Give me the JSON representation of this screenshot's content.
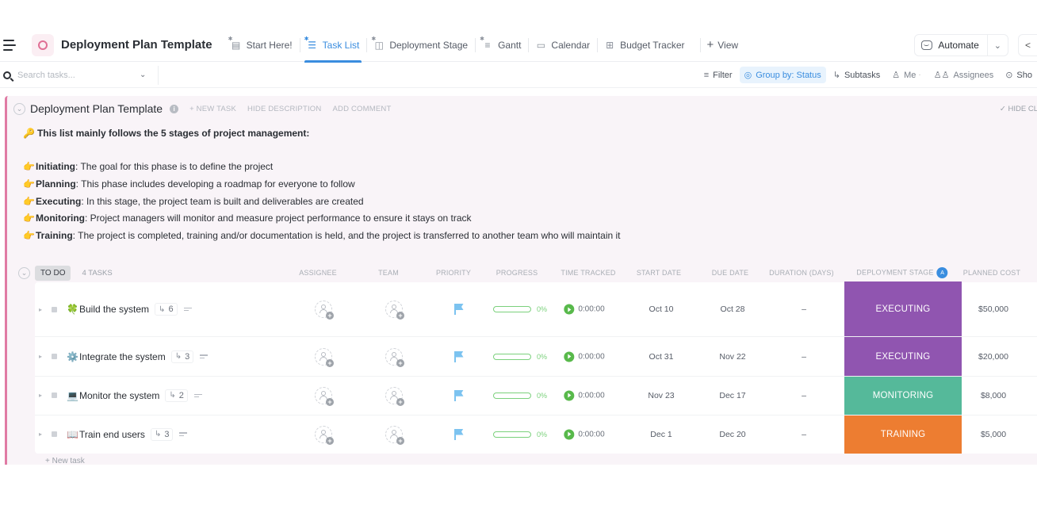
{
  "header": {
    "list_title": "Deployment Plan Template",
    "tabs": [
      {
        "label": "Start Here!",
        "icon": "doc-icon",
        "active": false
      },
      {
        "label": "Task List",
        "icon": "list-icon",
        "active": true
      },
      {
        "label": "Deployment Stage",
        "icon": "board-icon",
        "active": false
      },
      {
        "label": "Gantt",
        "icon": "gantt-icon",
        "active": false
      },
      {
        "label": "Calendar",
        "icon": "calendar-icon",
        "active": false
      },
      {
        "label": "Budget Tracker",
        "icon": "table-icon",
        "active": false
      }
    ],
    "add_view_label": "View",
    "automate_label": "Automate"
  },
  "toolbar": {
    "search_placeholder": "Search tasks...",
    "filter_label": "Filter",
    "group_by_label": "Group by: Status",
    "subtasks_label": "Subtasks",
    "me_label": "Me",
    "assignees_label": "Assignees",
    "show_label": "Sho"
  },
  "list": {
    "title": "Deployment Plan Template",
    "actions": [
      "+ NEW TASK",
      "HIDE DESCRIPTION",
      "ADD COMMENT"
    ],
    "hide_closed_label": "HIDE CL",
    "description": {
      "intro": "This list mainly follows the 5 stages of project management:",
      "stages": [
        {
          "name": "Initiating",
          "text": ": The goal for this phase is to define the project"
        },
        {
          "name": "Planning",
          "text": ": This phase includes developing a roadmap for everyone to follow"
        },
        {
          "name": "Executing",
          "text": ": In this stage, the project team is built and deliverables are created"
        },
        {
          "name": "Monitoring",
          "text": ": Project managers will monitor and measure project performance to ensure it stays on track"
        },
        {
          "name": "Training",
          "text": ": The project is completed, training and/or documentation is held, and the project is transferred to another team who will maintain it"
        }
      ]
    }
  },
  "group": {
    "status": "TO DO",
    "count_label": "4 TASKS",
    "columns": {
      "assignee": "ASSIGNEE",
      "team": "TEAM",
      "priority": "PRIORITY",
      "progress": "PROGRESS",
      "time_tracked": "TIME TRACKED",
      "start_date": "START DATE",
      "due_date": "DUE DATE",
      "duration": "DURATION (DAYS)",
      "deployment_stage": "DEPLOYMENT STAGE",
      "sort_badge": "A",
      "planned_cost": "PLANNED COST"
    },
    "new_task_label": "+ New task"
  },
  "tasks": [
    {
      "emoji": "🍀",
      "name": "Build the system",
      "subtasks": "6",
      "progress": 0,
      "progress_label": "0%",
      "time": "0:00:00",
      "start": "Oct 10",
      "due": "Oct 28",
      "duration": "–",
      "stage": "EXECUTING",
      "stage_color": "#9055b0",
      "cost": "$50,000"
    },
    {
      "emoji": "⚙️",
      "name": "Integrate the system",
      "subtasks": "3",
      "progress": 0,
      "progress_label": "0%",
      "time": "0:00:00",
      "start": "Oct 31",
      "due": "Nov 22",
      "duration": "–",
      "stage": "EXECUTING",
      "stage_color": "#9055b0",
      "cost": "$20,000"
    },
    {
      "emoji": "💻",
      "name": "Monitor the system",
      "subtasks": "2",
      "progress": 0,
      "progress_label": "0%",
      "time": "0:00:00",
      "start": "Nov 23",
      "due": "Dec 17",
      "duration": "–",
      "stage": "MONITORING",
      "stage_color": "#55b99a",
      "cost": "$8,000"
    },
    {
      "emoji": "📖",
      "name": "Train end users",
      "subtasks": "3",
      "progress": 0,
      "progress_label": "0%",
      "time": "0:00:00",
      "start": "Dec 1",
      "due": "Dec 20",
      "duration": "–",
      "stage": "TRAINING",
      "stage_color": "#ed7d31",
      "cost": "$5,000"
    }
  ]
}
